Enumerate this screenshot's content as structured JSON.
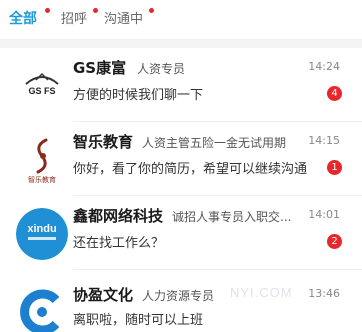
{
  "tabs": [
    {
      "label": "全部",
      "active": true,
      "has_dot": true
    },
    {
      "label": "招呼",
      "active": false,
      "has_dot": true
    },
    {
      "label": "沟通中",
      "active": false,
      "has_dot": true
    }
  ],
  "conversations": [
    {
      "name": "GS康富",
      "role": "人资专员",
      "time": "14:24",
      "message": "方便的时候我们聊一下",
      "unread": "4",
      "avatar": {
        "logo_text": "GS FS",
        "icon": "gs-kangfu-logo-icon",
        "bg": "#ffffff"
      }
    },
    {
      "name": "智乐教育",
      "role": "人资主管五险一金无试用期",
      "time": "14:15",
      "message": "你好，看了你的简历，希望可以继续沟通",
      "unread": "1",
      "avatar": {
        "logo_text": "智乐教育",
        "icon": "zhile-education-logo-icon",
        "bg": "#ffffff"
      }
    },
    {
      "name": "鑫都网络科技",
      "role": "诚招人事专员入职交...",
      "time": "14:01",
      "message": "还在找工作么？",
      "unread": "2",
      "avatar": {
        "logo_text": "xindu",
        "icon": "xindu-network-logo-icon",
        "bg": "#1f8fd6"
      }
    },
    {
      "name": "协盈文化",
      "role": "人力资源专员",
      "time": "13:46",
      "message": "离职啦，随时可以上班",
      "unread": "",
      "avatar": {
        "logo_text": "",
        "icon": "xieying-culture-logo-icon",
        "bg": "#1d7fd0"
      }
    }
  ],
  "watermark": "NYI.COM",
  "colors": {
    "accent": "#1d9bd8",
    "badge": "#e8262b",
    "divider": "#eeeeee"
  }
}
